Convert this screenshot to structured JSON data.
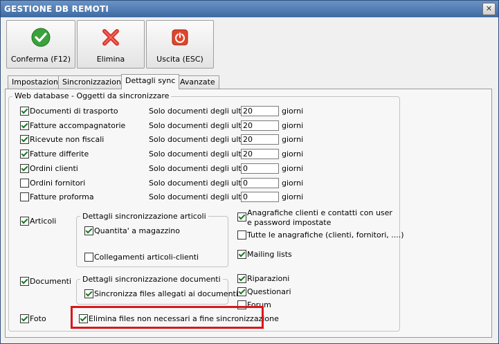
{
  "window": {
    "title": "GESTIONE DB REMOTI",
    "close_icon": "close-icon"
  },
  "toolbar": {
    "confirm": {
      "label": "Conferma (F12)",
      "icon": "checkmark-icon"
    },
    "delete": {
      "label": "Elimina",
      "icon": "x-icon"
    },
    "exit": {
      "label": "Uscita (ESC)",
      "icon": "power-icon"
    }
  },
  "tabs": [
    "Impostazioni",
    "Sincronizzazione",
    "Dettagli sync",
    "Avanzate"
  ],
  "active_tab": "Dettagli sync",
  "group_title": "Web database - Oggetti da sincronizzare",
  "doc_rows": [
    {
      "label": "Documenti di trasporto",
      "checked": true,
      "prefix": "Solo documenti degli ultimi",
      "value": "20",
      "suffix": "giorni"
    },
    {
      "label": "Fatture accompagnatorie",
      "checked": true,
      "prefix": "Solo documenti degli ultimi",
      "value": "20",
      "suffix": "giorni"
    },
    {
      "label": "Ricevute non fiscali",
      "checked": true,
      "prefix": "Solo documenti degli ultimi",
      "value": "20",
      "suffix": "giorni"
    },
    {
      "label": "Fatture differite",
      "checked": true,
      "prefix": "Solo documenti degli ultimi",
      "value": "20",
      "suffix": "giorni"
    },
    {
      "label": "Ordini clienti",
      "checked": true,
      "prefix": "Solo documenti degli ultimi",
      "value": "0",
      "suffix": "giorni"
    },
    {
      "label": "Ordini fornitori",
      "checked": false,
      "prefix": "Solo documenti degli ultimi",
      "value": "0",
      "suffix": "giorni"
    },
    {
      "label": "Fatture proforma",
      "checked": false,
      "prefix": "Solo documenti degli ultimi",
      "value": "0",
      "suffix": "giorni"
    }
  ],
  "articoli": {
    "label": "Articoli",
    "checked": true
  },
  "articoli_group": {
    "title": "Dettagli sincronizzazione articoli",
    "items": [
      {
        "label": "Quantita' a magazzino",
        "checked": true
      },
      {
        "label": "Collegamenti articoli-clienti",
        "checked": false
      }
    ]
  },
  "documenti": {
    "label": "Documenti",
    "checked": true
  },
  "documenti_group": {
    "title": "Dettagli sincronizzazione documenti",
    "items": [
      {
        "label": "Sincronizza files allegati ai documenti",
        "checked": true
      }
    ]
  },
  "foto": {
    "label": "Foto",
    "checked": true
  },
  "elimina_files": {
    "label": "Elimina files non necessari a fine sincronizzazione",
    "checked": true
  },
  "right_options": [
    {
      "label": "Anagrafiche clienti e contatti con user e password impostate",
      "checked": true
    },
    {
      "label": "Tutte le anagrafiche (clienti, fornitori, ....)",
      "checked": false
    },
    {
      "label": "Mailing lists",
      "checked": true
    },
    {
      "label": "Riparazioni",
      "checked": true
    },
    {
      "label": "Questionari",
      "checked": true
    },
    {
      "label": "Forum",
      "checked": false
    }
  ],
  "colors": {
    "highlight": "#d8171b",
    "title_bar": "#4a78b0"
  }
}
